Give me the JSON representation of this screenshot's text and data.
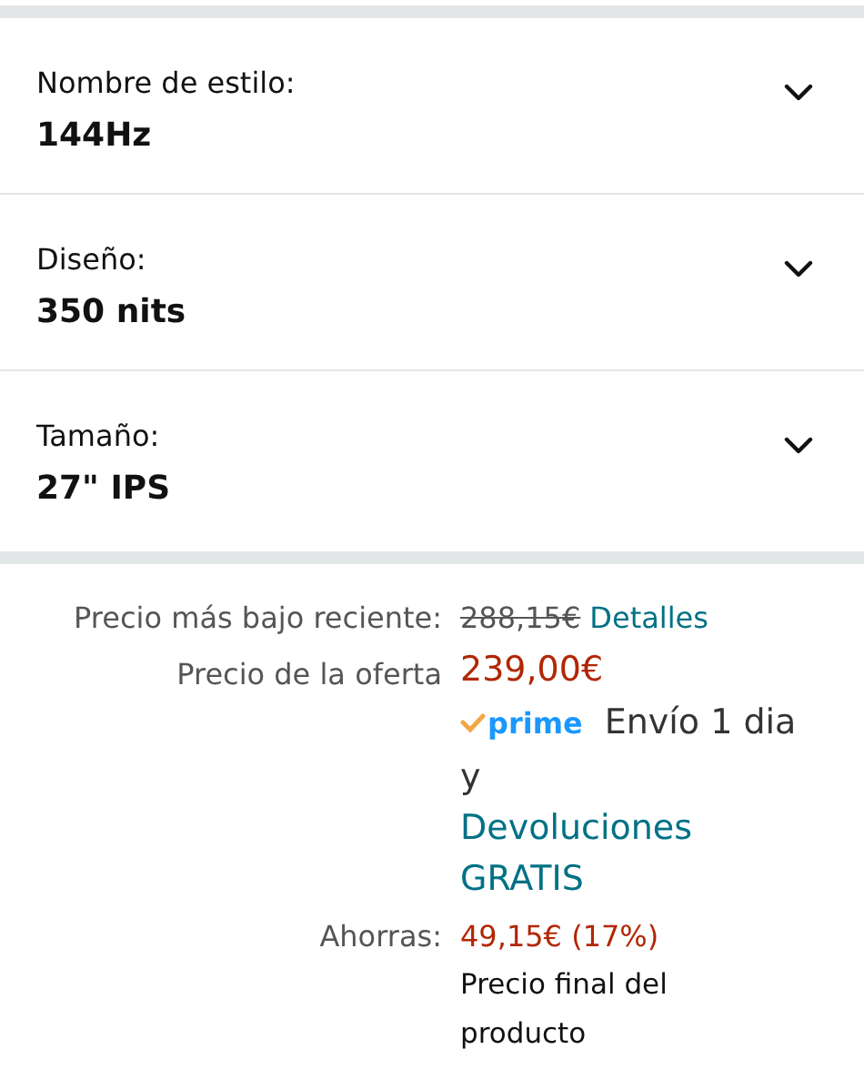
{
  "variations": [
    {
      "label": "Nombre de estilo:",
      "value": "144Hz",
      "expanded": false
    },
    {
      "label": "Diseño:",
      "value": "350 nits",
      "expanded": false
    },
    {
      "label": "Tamaño:",
      "value": "27\" IPS",
      "expanded": false
    }
  ],
  "price": {
    "recent_low_label": "Precio más bajo reciente:",
    "recent_low_price": "288,15€",
    "details_link": "Detalles",
    "offer_label": "Precio de la oferta",
    "offer_price": "239,00€",
    "prime_logo": "prime",
    "delivery": "Envío 1 dia",
    "conjunction": "y",
    "returns_link": "Devoluciones GRATIS",
    "savings_label": "Ahorras:",
    "savings": "49,15€ (17%)",
    "final_note": "Precio final del producto"
  }
}
